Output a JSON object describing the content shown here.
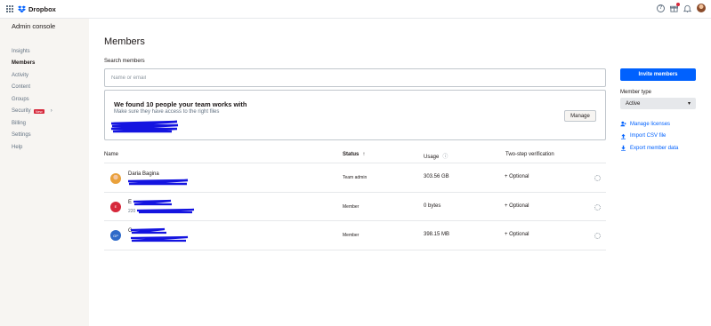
{
  "app": {
    "brand": "Dropbox",
    "brand_color": "#0061fe",
    "avatar_initials": ""
  },
  "topbar": {
    "icons": [
      "apps-grid-icon",
      "help-icon",
      "gift-icon",
      "bell-icon",
      "user-avatar"
    ]
  },
  "sidebar": {
    "title": "Admin console",
    "items": [
      {
        "label": "Insights",
        "active": false
      },
      {
        "label": "Members",
        "active": true
      },
      {
        "label": "Activity",
        "active": false
      },
      {
        "label": "Content",
        "active": false
      },
      {
        "label": "Groups",
        "active": false
      },
      {
        "label": "Security",
        "active": false,
        "badge": "New"
      },
      {
        "label": "Billing",
        "active": false
      },
      {
        "label": "Settings",
        "active": false
      },
      {
        "label": "Help",
        "active": false
      }
    ]
  },
  "main": {
    "title": "Members",
    "search_label": "Search members",
    "search_placeholder": "Name or email",
    "found_title": "We found 10 people your team works with",
    "found_subtitle": "Make sure they have access to the right files",
    "manage_label": "Manage",
    "table": {
      "headers": {
        "name": "Name",
        "status": "Status",
        "usage": "Usage",
        "two_step": "Two-step verification"
      },
      "rows": [
        {
          "avatar": "",
          "avatar_color": "#e9a13b",
          "name": "Daria Bagina",
          "sub": "",
          "status": "Team admin",
          "usage": "303.56 GB",
          "two_step": "+ Optional"
        },
        {
          "avatar": "E",
          "avatar_color": "#d6283b",
          "name": "E",
          "sub": "220",
          "status": "Member",
          "usage": "0 bytes",
          "two_step": "+ Optional"
        },
        {
          "avatar": "GP",
          "avatar_color": "#2f6ac9",
          "name": "G",
          "sub": "",
          "status": "Member",
          "usage": "398.15 MB",
          "two_step": "+ Optional"
        }
      ]
    }
  },
  "right_panel": {
    "invite_label": "Invite members",
    "member_type_label": "Member type",
    "member_type_value": "Active",
    "links": [
      {
        "label": "Manage licenses",
        "icon": "person-add-icon"
      },
      {
        "label": "Import CSV file",
        "icon": "upload-icon"
      },
      {
        "label": "Export member data",
        "icon": "download-icon"
      }
    ]
  }
}
